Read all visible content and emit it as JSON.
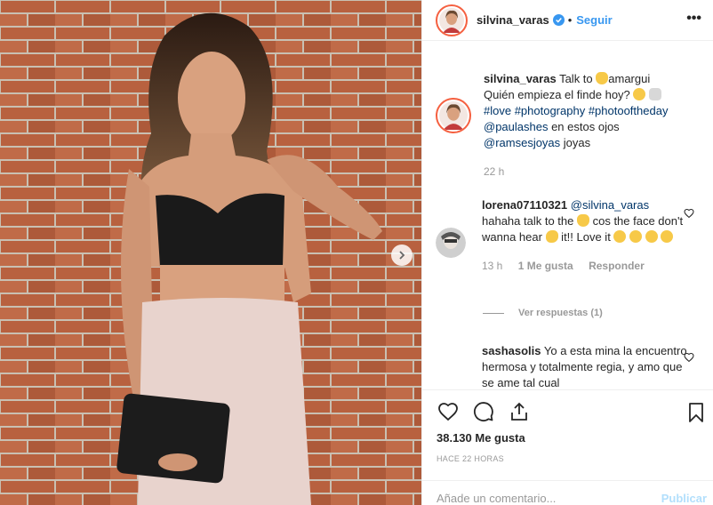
{
  "post": {
    "author": "silvina_varas",
    "follow_label": "Seguir",
    "separator": "•",
    "more_label": "•••"
  },
  "caption": {
    "username": "silvina_varas",
    "text_part1": "Talk to ",
    "text_part2": "amargui",
    "text_line2": "Quién empieza el finde hoy?",
    "hashtags": "#love #photography #photooftheday",
    "mention1": "@paulashes",
    "mention1_suffix": " en estos ojos",
    "mention2": "@ramsesjoyas",
    "mention2_suffix": " joyas",
    "time": "22 h"
  },
  "comments": [
    {
      "username": "lorena07110321",
      "mention": "@silvina_varas",
      "text1": "hahaha talk to the ",
      "text2": " cos the face don't wanna hear ",
      "text3": " it!! Love it ",
      "time": "13 h",
      "likes": "1 Me gusta",
      "reply": "Responder"
    },
    {
      "username": "sashasolis",
      "text": "Yo a esta mina la encuentro hermosa y totalmente regia, y amo que se ame tal cual"
    }
  ],
  "replies_label": "Ver respuestas (1)",
  "likes_count": "38.130 Me gusta",
  "time_ago": "HACE 22 HORAS",
  "composer": {
    "placeholder": "Añade un comentario...",
    "publish_label": "Publicar"
  },
  "colors": {
    "accent": "#3897f0",
    "link": "#003569",
    "muted": "#999999",
    "publish_disabled": "#b2dffc",
    "brick": "#b5674a"
  },
  "icons": [
    "verified-icon",
    "heart-icon",
    "comment-icon",
    "share-icon",
    "bookmark-icon",
    "chevron-right-icon",
    "more-icon"
  ]
}
